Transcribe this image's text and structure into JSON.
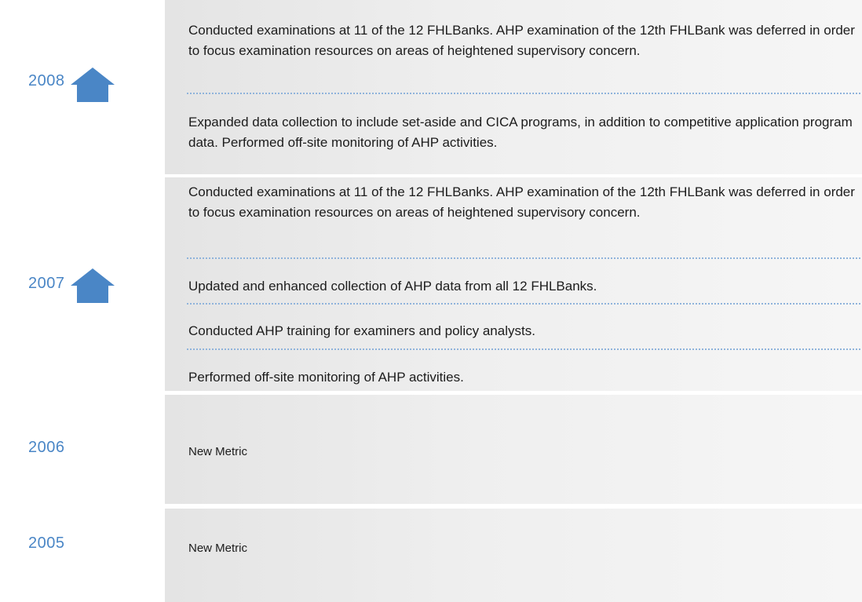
{
  "colors": {
    "year_blue": "#4a86c6",
    "house_blue": "#4a86c6",
    "separator": "#8fb3db",
    "panel_gray": "#ececec"
  },
  "rows": [
    {
      "year": "2008",
      "icon": "house-icon",
      "entries": [
        "Conducted examinations at 11 of the 12 FHLBanks. AHP examination of the 12th FHLBank was deferred in order to focus examination resources on areas of heightened supervisory concern.",
        "Expanded data collection to include set-aside and CICA programs, in addition to competitive application program data. Performed off-site monitoring of AHP activities."
      ]
    },
    {
      "year": "2007",
      "icon": "house-icon",
      "entries": [
        "Conducted examinations at 11 of the 12 FHLBanks. AHP examination of the 12th FHLBank was deferred in order to focus examination resources on areas of heightened supervisory concern.",
        "Updated and enhanced collection of AHP data from all 12 FHLBanks.",
        "Conducted AHP training for examiners and policy analysts.",
        "Performed off-site monitoring of AHP activities."
      ]
    },
    {
      "year": "2006",
      "metric": "New Metric"
    },
    {
      "year": "2005",
      "metric": "New Metric"
    }
  ]
}
